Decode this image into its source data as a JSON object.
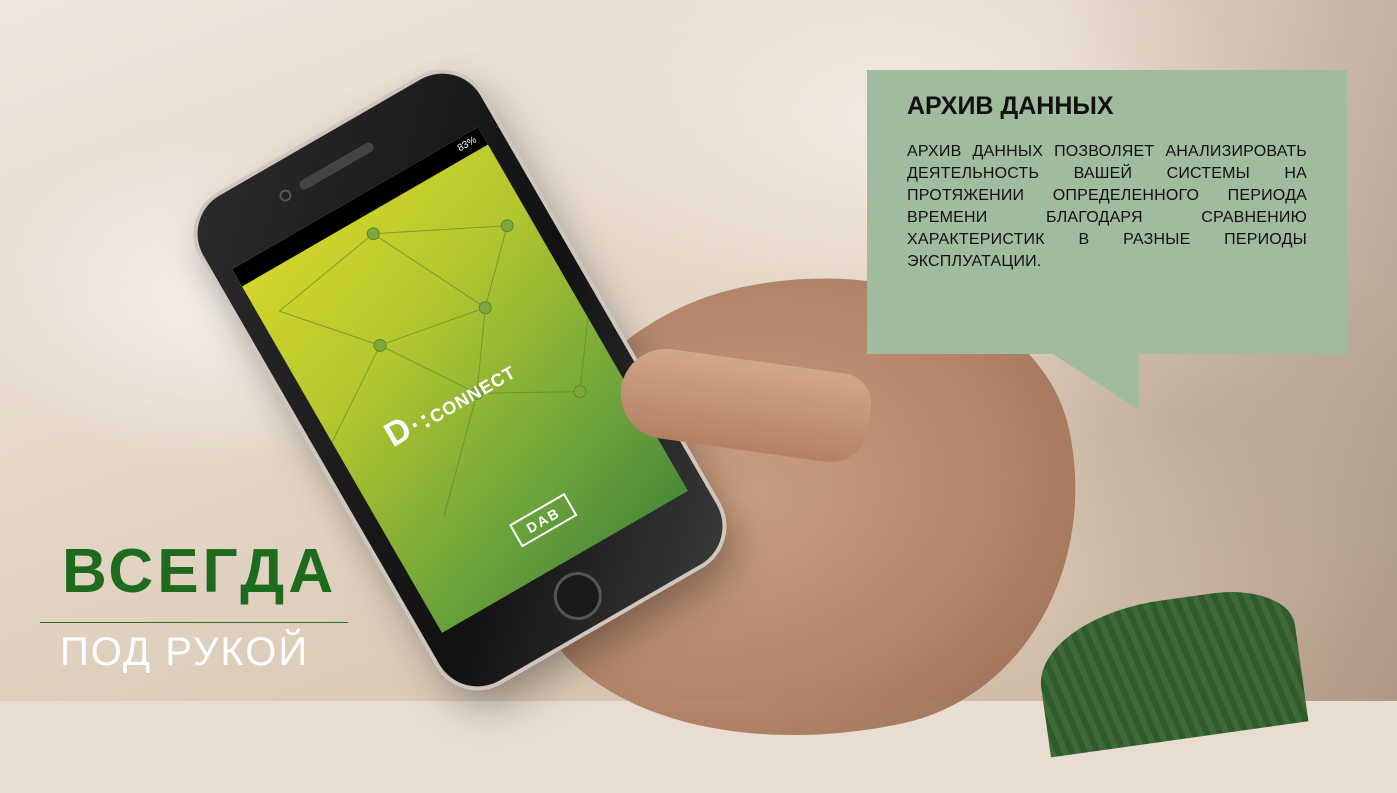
{
  "screen": {
    "status_text": "83%",
    "app_logo_prefix": "D",
    "app_logo_mark": "·:",
    "app_logo_name": "CONNECT",
    "brand_logo": "DAB"
  },
  "callout": {
    "title": "АРХИВ ДАННЫХ",
    "text": "АРХИВ ДАННЫХ ПОЗВОЛЯЕТ АНАЛИЗИРОВАТЬ ДЕЯТЕЛЬНОСТЬ ВАШЕЙ СИСТЕМЫ НА ПРОТЯЖЕНИИ ОПРЕДЕЛЕННОГО ПЕРИОДА ВРЕМЕНИ БЛАГОДАРЯ СРАВНЕНИЮ ХАРАКТЕРИСТИК В РАЗНЫЕ ПЕРИОДЫ ЭКСПЛУАТАЦИИ."
  },
  "tagline": {
    "main": "ВСЕГДА",
    "sub": "ПОД РУКОЙ"
  },
  "colors": {
    "callout_bg": "#a1bb9e",
    "tagline_green": "#1f6b1d",
    "tagline_white": "#ffffff"
  }
}
